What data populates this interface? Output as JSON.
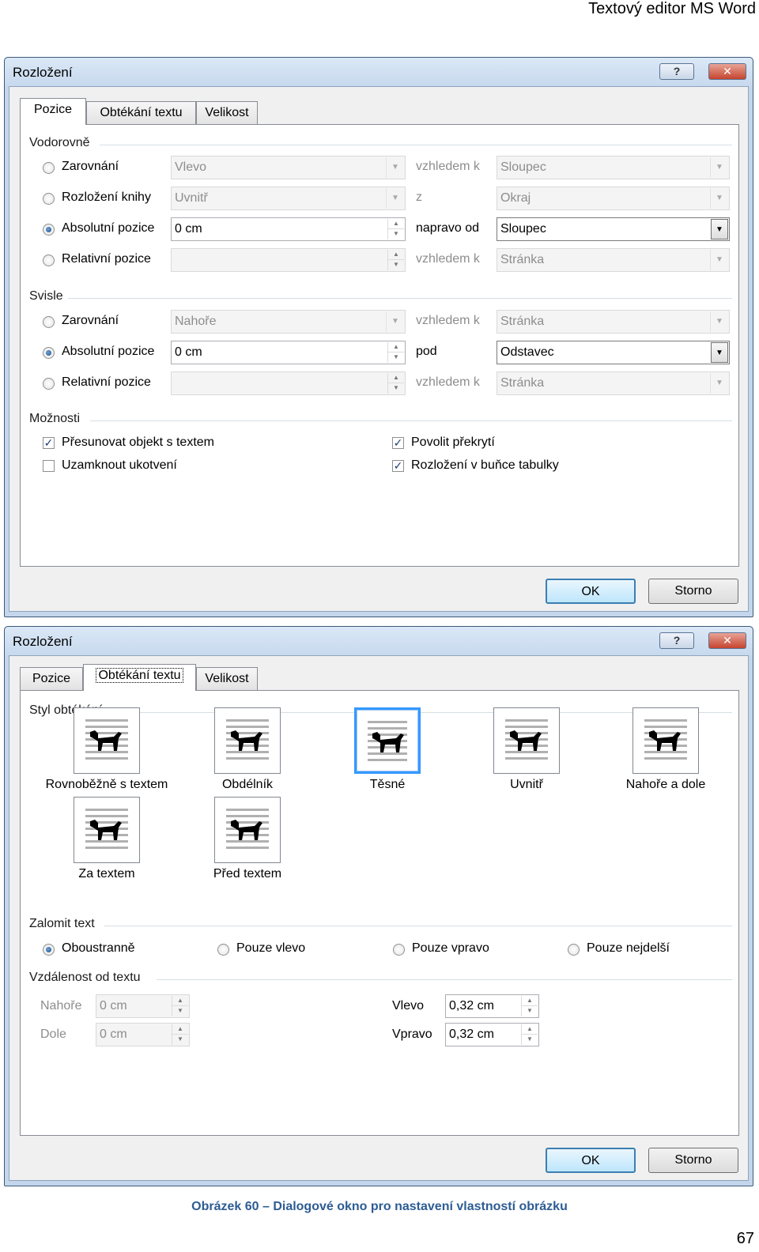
{
  "page_header": "Textový editor MS Word",
  "dialog1": {
    "title": "Rozložení",
    "help_label": "?",
    "close_label": "✕",
    "tabs": [
      "Pozice",
      "Obtékání textu",
      "Velikost"
    ],
    "horizontal": {
      "heading": "Vodorovně",
      "rows": [
        {
          "label": "Zarovnání",
          "value": "Vlevo",
          "rel_label": "vzhledem k",
          "rel_value": "Sloupec"
        },
        {
          "label": "Rozložení knihy",
          "value": "Uvnitř",
          "rel_label": "z",
          "rel_value": "Okraj"
        },
        {
          "label": "Absolutní pozice",
          "value": "0 cm",
          "rel_label": "napravo od",
          "rel_value": "Sloupec"
        },
        {
          "label": "Relativní pozice",
          "value": "",
          "rel_label": "vzhledem k",
          "rel_value": "Stránka"
        }
      ]
    },
    "vertical": {
      "heading": "Svisle",
      "rows": [
        {
          "label": "Zarovnání",
          "value": "Nahoře",
          "rel_label": "vzhledem k",
          "rel_value": "Stránka"
        },
        {
          "label": "Absolutní pozice",
          "value": "0 cm",
          "rel_label": "pod",
          "rel_value": "Odstavec"
        },
        {
          "label": "Relativní pozice",
          "value": "",
          "rel_label": "vzhledem k",
          "rel_value": "Stránka"
        }
      ]
    },
    "options": {
      "heading": "Možnosti",
      "move_with_text": "Přesunovat objekt s textem",
      "lock_anchor": "Uzamknout ukotvení",
      "allow_overlap": "Povolit překrytí",
      "layout_in_cell": "Rozložení v buňce tabulky"
    },
    "ok": "OK",
    "cancel": "Storno"
  },
  "dialog2": {
    "title": "Rozložení",
    "help_label": "?",
    "close_label": "✕",
    "tabs": [
      "Pozice",
      "Obtékání textu",
      "Velikost"
    ],
    "wrap_heading": "Styl obtékání",
    "wrap_styles": [
      "Rovnoběžně s textem",
      "Obdélník",
      "Těsné",
      "Uvnitř",
      "Nahoře a dole",
      "Za textem",
      "Před textem"
    ],
    "break_heading": "Zalomit text",
    "break_options": [
      "Oboustranně",
      "Pouze vlevo",
      "Pouze vpravo",
      "Pouze nejdelší"
    ],
    "distance_heading": "Vzdálenost od textu",
    "top_label": "Nahoře",
    "top_value": "0 cm",
    "bottom_label": "Dole",
    "bottom_value": "0 cm",
    "left_label": "Vlevo",
    "left_value": "0,32 cm",
    "right_label": "Vpravo",
    "right_value": "0,32 cm",
    "ok": "OK",
    "cancel": "Storno"
  },
  "caption": "Obrázek 60 – Dialogové okno pro nastavení vlastností obrázku",
  "page_number": "67",
  "colors": {
    "accent": "#3399ff",
    "caption": "#2d5c93",
    "titlebar": "#c7d9ee",
    "close": "#c5452e"
  },
  "icons": [
    "help-icon",
    "close-icon",
    "dropdown-arrow-icon",
    "spin-arrows-icon",
    "dog-image-icon"
  ]
}
